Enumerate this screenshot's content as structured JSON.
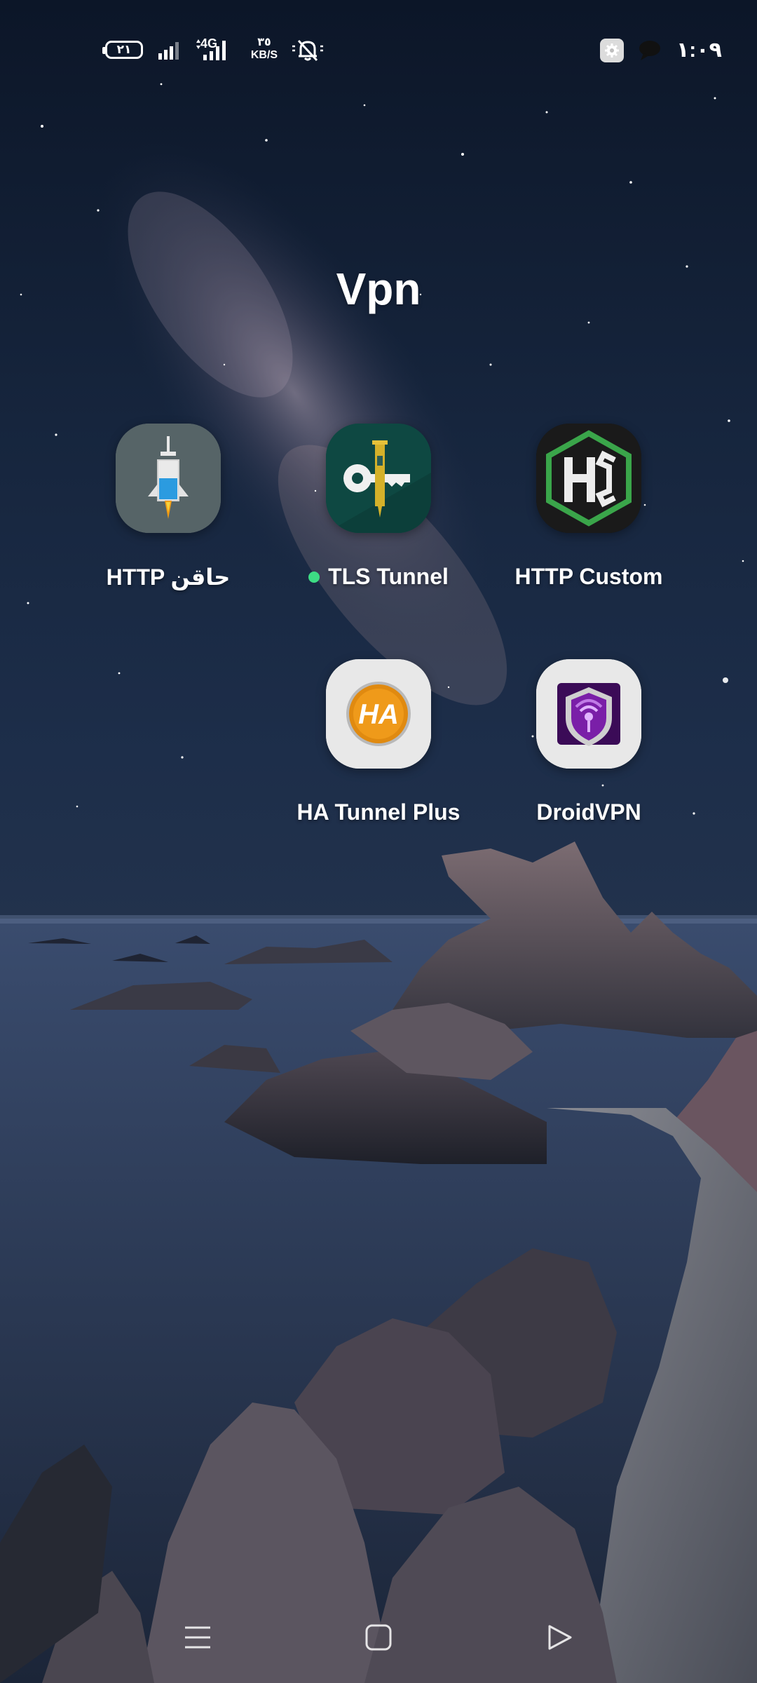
{
  "status_bar": {
    "battery_level": "٢١",
    "network_type": "4G",
    "speed_value": "٣٥",
    "speed_unit": "KB/S",
    "time": "١:٠٩",
    "icons": [
      "battery-icon",
      "signal-icon",
      "signal-4g-icon",
      "bell-muted-icon",
      "gear-icon",
      "chat-bubble-icon"
    ]
  },
  "folder": {
    "title": "Vpn",
    "apps": [
      {
        "label": "HTTP حاقن",
        "icon": "http-injector-icon",
        "new": false
      },
      {
        "label": "TLS Tunnel",
        "icon": "tls-tunnel-icon",
        "new": true
      },
      {
        "label": "HTTP Custom",
        "icon": "http-custom-icon",
        "new": false
      },
      {
        "label": "HA Tunnel Plus",
        "icon": "ha-tunnel-icon",
        "new": false
      },
      {
        "label": "DroidVPN",
        "icon": "droidvpn-icon",
        "new": false
      }
    ]
  },
  "nav_bar": {
    "icons": [
      "menu-icon",
      "home-icon",
      "back-icon"
    ]
  },
  "colors": {
    "new_badge": "#3ddc84",
    "label_text": "#ffffff"
  }
}
